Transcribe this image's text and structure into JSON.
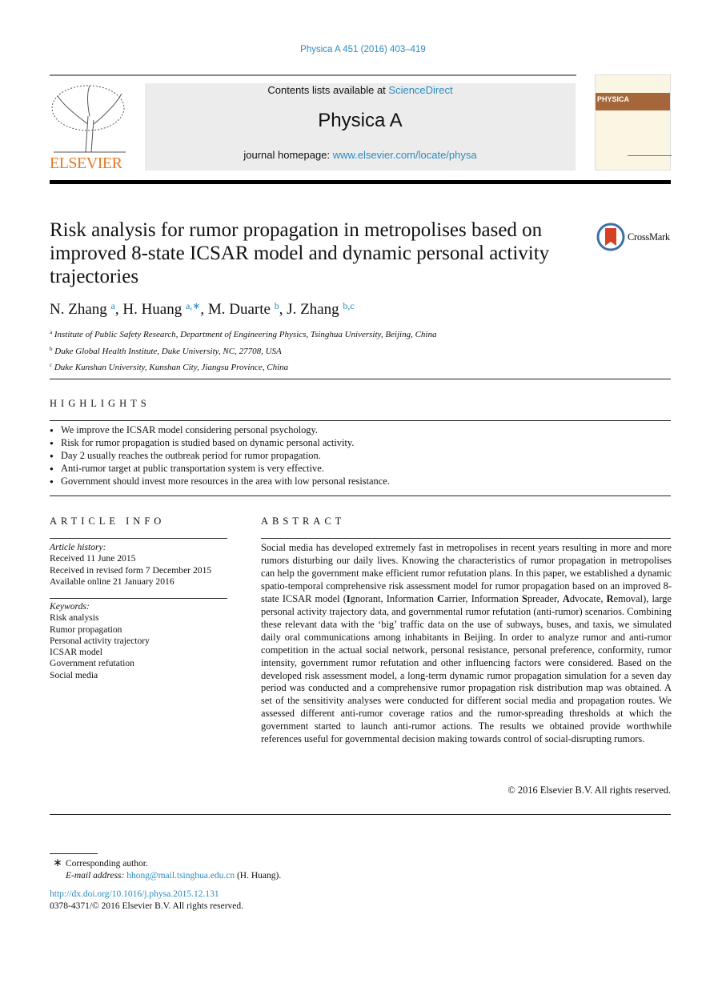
{
  "header": {
    "citation": "Physica A 451 (2016) 403–419",
    "contents_prefix": "Contents lists available at ",
    "sciencedirect": "ScienceDirect",
    "journal": "Physica A",
    "homepage_prefix": "journal homepage: ",
    "homepage_url": "www.elsevier.com/locate/physa",
    "publisher_logo": "ELSEVIER",
    "cover_title": "PHYSICA"
  },
  "title": "Risk analysis for rumor propagation in metropolises based on improved 8-state ICSAR model and dynamic personal activity trajectories",
  "crossmark": "CrossMark",
  "authors": [
    {
      "name": "N. Zhang",
      "sup": "a"
    },
    {
      "name": "H. Huang",
      "sup": "a,∗"
    },
    {
      "name": "M. Duarte",
      "sup": "b"
    },
    {
      "name": "J. Zhang",
      "sup": "b,c"
    }
  ],
  "affiliations": [
    {
      "sup": "a",
      "text": "Institute of Public Safety Research, Department of Engineering Physics, Tsinghua University, Beijing, China"
    },
    {
      "sup": "b",
      "text": "Duke Global Health Institute, Duke University, NC, 27708, USA"
    },
    {
      "sup": "c",
      "text": "Duke Kunshan University, Kunshan City, Jiangsu Province, China"
    }
  ],
  "highlights": {
    "heading": "HIGHLIGHTS",
    "items": [
      "We improve the ICSAR model considering personal psychology.",
      "Risk for rumor propagation is studied based on dynamic personal activity.",
      "Day 2 usually reaches the outbreak period for rumor propagation.",
      "Anti-rumor target at public transportation system is very effective.",
      "Government should invest more resources in the area with low personal resistance."
    ]
  },
  "article_info": {
    "heading": "ARTICLE INFO",
    "history_label": "Article history:",
    "history": [
      "Received 11 June 2015",
      "Received in revised form 7 December 2015",
      "Available online 21 January 2016"
    ],
    "keywords_label": "Keywords:",
    "keywords": [
      "Risk analysis",
      "Rumor propagation",
      "Personal activity trajectory",
      "ICSAR model",
      "Government refutation",
      "Social media"
    ]
  },
  "abstract": {
    "heading": "ABSTRACT",
    "parts": [
      {
        "t": "Social media has developed extremely fast in metropolises in recent years resulting in more and more rumors disturbing our daily lives. Knowing the characteristics of rumor propagation in metropolises can help the government make efficient rumor refutation plans. In this paper, we established a dynamic spatio-temporal comprehensive risk assessment model for rumor propagation based on an improved 8-state ICSAR model (",
        "b": false
      },
      {
        "t": "I",
        "b": true
      },
      {
        "t": "gnorant, Information ",
        "b": false
      },
      {
        "t": "C",
        "b": true
      },
      {
        "t": "arrier, Information ",
        "b": false
      },
      {
        "t": "S",
        "b": true
      },
      {
        "t": "preader, ",
        "b": false
      },
      {
        "t": "A",
        "b": true
      },
      {
        "t": "dvocate, ",
        "b": false
      },
      {
        "t": "R",
        "b": true
      },
      {
        "t": "emoval), large personal activity trajectory data, and governmental rumor refutation (anti-rumor) scenarios. Combining these relevant data with the ‘big’ traffic data on the use of subways, buses, and taxis, we simulated daily oral communications among inhabitants in Beijing. In order to analyze rumor and anti-rumor competition in the actual social network, personal resistance, personal preference, conformity, rumor intensity, government rumor refutation and other influencing factors were considered. Based on the developed risk assessment model, a long-term dynamic rumor propagation simulation for a seven day period was conducted and a comprehensive rumor propagation risk distribution map was obtained. A set of the sensitivity analyses were conducted for different social media and propagation routes. We assessed different anti-rumor coverage ratios and the rumor-spreading thresholds at which the government started to launch anti-rumor actions. The results we obtained provide worthwhile references useful for governmental decision making towards control of social-disrupting rumors.",
        "b": false
      }
    ],
    "copyright": "© 2016 Elsevier B.V. All rights reserved."
  },
  "footnotes": {
    "star": "∗",
    "corresponding": "Corresponding author.",
    "email_label": "E-mail address: ",
    "email": "hhong@mail.tsinghua.edu.cn",
    "email_suffix": " (H. Huang).",
    "doi": "http://dx.doi.org/10.1016/j.physa.2015.12.131",
    "issn": "0378-4371/© 2016 Elsevier B.V. All rights reserved."
  },
  "colors": {
    "link": "#2a8bbf",
    "elsevier": "#e87722",
    "header_box": "#ececec"
  }
}
